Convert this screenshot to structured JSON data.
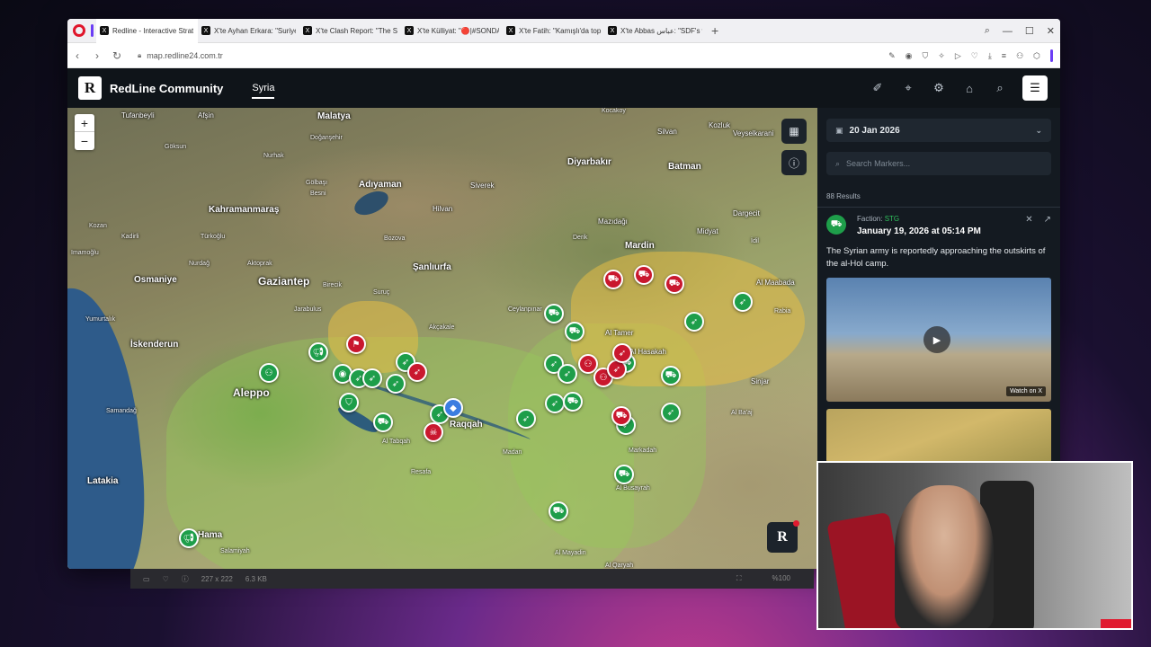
{
  "browser": {
    "tabs": [
      {
        "icon": "X",
        "label": "Redline - Interactive Strat"
      },
      {
        "icon": "X",
        "label": "X'te Ayhan Erkara: \"Suriye"
      },
      {
        "icon": "X",
        "label": "X'te Clash Report: \"The Sy"
      },
      {
        "icon": "X",
        "label": "X'te Külliyat: \"🔴|#SONDA"
      },
      {
        "icon": "X",
        "label": "X'te Fatih: \"Kamışlı'da top"
      },
      {
        "icon": "X",
        "label": "X'te Abbas عباس: \"SDF's w"
      }
    ],
    "new_tab": "+",
    "url": "map.redline24.com.tr"
  },
  "app": {
    "logo": "R",
    "name": "RedLine Community",
    "region": "Syria"
  },
  "map": {
    "zoom_in": "+",
    "zoom_out": "−",
    "logo": "R",
    "labels": [
      {
        "text": "Tufanbeyli"
      },
      {
        "text": "Afşin"
      },
      {
        "text": "Malatya"
      },
      {
        "text": "Doğanşehir"
      },
      {
        "text": "Kocakoy"
      },
      {
        "text": "Silvan"
      },
      {
        "text": "Kozluk"
      },
      {
        "text": "Veyselkarani"
      },
      {
        "text": "Göksun"
      },
      {
        "text": "Nurhak"
      },
      {
        "text": "Adıyaman"
      },
      {
        "text": "Siverek"
      },
      {
        "text": "Diyarbakır"
      },
      {
        "text": "Batman"
      },
      {
        "text": "Kahramanmaraş"
      },
      {
        "text": "Gölbaşı"
      },
      {
        "text": "Besni"
      },
      {
        "text": "Hilvan"
      },
      {
        "text": "Mazıdağı"
      },
      {
        "text": "Dargecit"
      },
      {
        "text": "Midyat"
      },
      {
        "text": "Kozan"
      },
      {
        "text": "Kadirli"
      },
      {
        "text": "Türkoğlu"
      },
      {
        "text": "Bozova"
      },
      {
        "text": "Derik"
      },
      {
        "text": "Mardin"
      },
      {
        "text": "İdil"
      },
      {
        "text": "Imamoğlu"
      },
      {
        "text": "Nurdağ"
      },
      {
        "text": "Aktoprak"
      },
      {
        "text": "Şanlıurfa"
      },
      {
        "text": "Osmaniye"
      },
      {
        "text": "Gaziantep"
      },
      {
        "text": "Birecik"
      },
      {
        "text": "Suruç"
      },
      {
        "text": "Ceylanpınar"
      },
      {
        "text": "Al Maabada"
      },
      {
        "text": "Yumurtalık"
      },
      {
        "text": "Jarabulus"
      },
      {
        "text": "Akçakale"
      },
      {
        "text": "Al Tamer"
      },
      {
        "text": "Rabia"
      },
      {
        "text": "İskenderun"
      },
      {
        "text": "Aleppo"
      },
      {
        "text": "Raqqah"
      },
      {
        "text": "Al Hasakah"
      },
      {
        "text": "Sinjar"
      },
      {
        "text": "Samandağ"
      },
      {
        "text": "Al Tabqah"
      },
      {
        "text": "Markadah"
      },
      {
        "text": "Al Ba'aj"
      },
      {
        "text": "Latakia"
      },
      {
        "text": "Resafa"
      },
      {
        "text": "Madan"
      },
      {
        "text": "Al Busayrah"
      },
      {
        "text": "Al Mayadin"
      },
      {
        "text": "Hama"
      },
      {
        "text": "Salamiyah"
      },
      {
        "text": "Al Qaryah"
      }
    ]
  },
  "panel": {
    "date": "20 Jan 2026",
    "search_placeholder": "Search Markers...",
    "results": "88 Results",
    "card": {
      "faction_label": "Faction:",
      "faction": "STG",
      "time": "January 19, 2026 at 05:14 PM",
      "text": "The Syrian army is reportedly approaching the outskirts of the al-Hol camp.",
      "watch": "Watch on X"
    }
  },
  "statusbar": {
    "dims": "227 x 222",
    "size": "6.3 KB",
    "zoom": "%100"
  },
  "colors": {
    "header_bg": "#0f1419",
    "panel_bg": "#141a21",
    "marker_green": "#1e9e4a",
    "marker_red": "#c9182e",
    "zone_yellow": "#e6be46"
  }
}
